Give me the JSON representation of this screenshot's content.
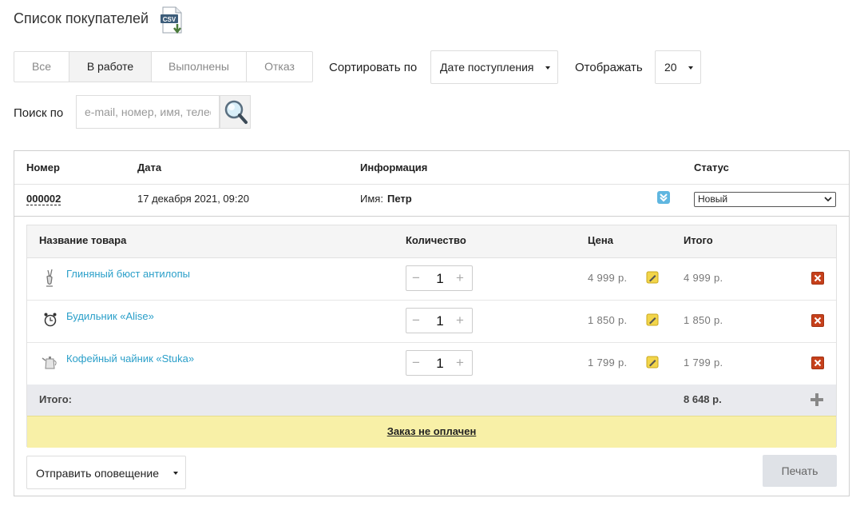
{
  "page": {
    "title": "Список покупателей",
    "csv_icon_text": "CSV"
  },
  "tabs": [
    "Все",
    "В работе",
    "Выполнены",
    "Отказ"
  ],
  "sort": {
    "label": "Сортировать по",
    "value": "Дате поступления"
  },
  "display": {
    "label": "Отображать",
    "value": "20"
  },
  "search": {
    "label": "Поиск по",
    "placeholder": "e-mail, номер, имя, телефон"
  },
  "orders_table": {
    "headers": {
      "number": "Номер",
      "date": "Дата",
      "info": "Информация",
      "status": "Статус"
    },
    "order": {
      "number": "000002",
      "date": "17 декабря 2021, 09:20",
      "name_label": "Имя:",
      "name_value": "Петр",
      "status": "Новый"
    }
  },
  "items_table": {
    "headers": {
      "product": "Название товара",
      "quantity": "Количество",
      "price": "Цена",
      "total": "Итого"
    },
    "items": [
      {
        "name": "Глиняный бюст антилопы",
        "qty": "1",
        "price": "4 999 р.",
        "total": "4 999 р."
      },
      {
        "name": "Будильник «Alise»",
        "qty": "1",
        "price": "1 850 р.",
        "total": "1 850 р."
      },
      {
        "name": "Кофейный чайник «Stuka»",
        "qty": "1",
        "price": "1 799 р.",
        "total": "1 799 р."
      }
    ],
    "total_label": "Итого:",
    "total_value": "8 648 р.",
    "unpaid_text": "Заказ не оплачен"
  },
  "actions": {
    "notify_label": "Отправить оповещение",
    "print_label": "Печать"
  },
  "colors": {
    "link": "#2a9fc9",
    "unpaid_bg": "#f8f0a7",
    "delete": "#c6401b",
    "total_bg": "#e9eaee"
  }
}
